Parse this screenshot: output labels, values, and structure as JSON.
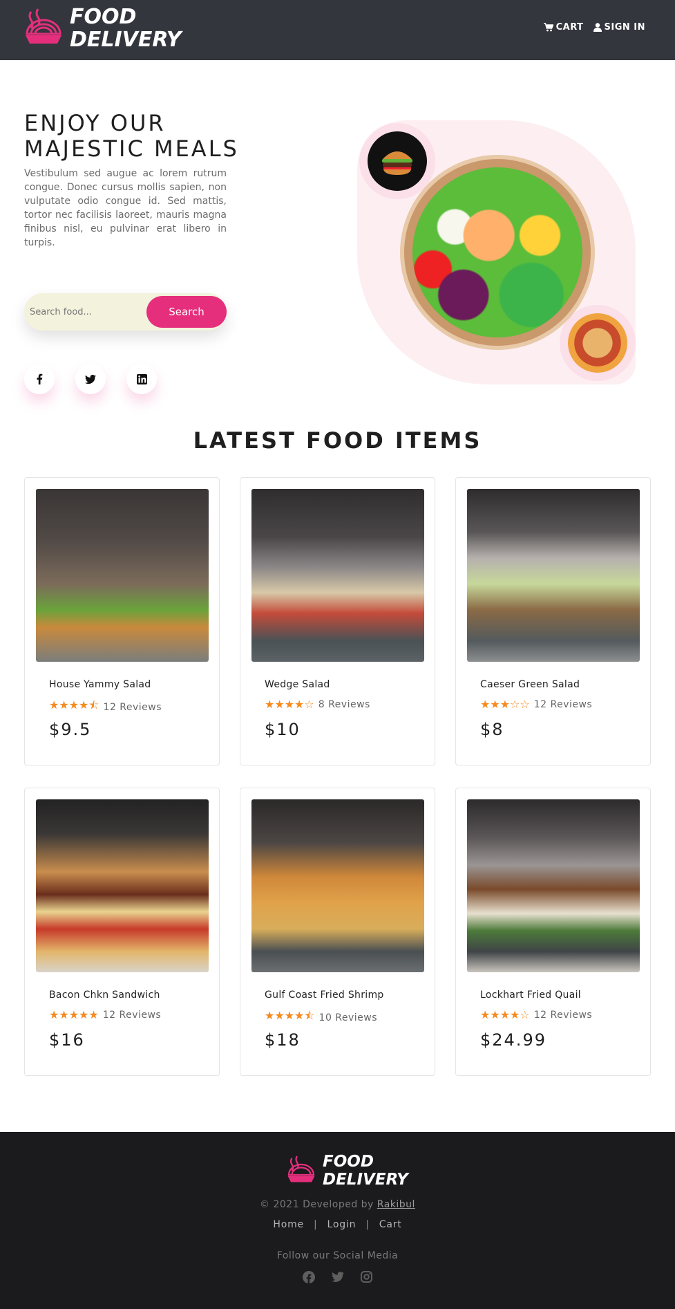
{
  "header": {
    "logo_line1": "FOOD",
    "logo_line2": "DELIVERY",
    "nav": [
      {
        "label": "CART",
        "icon": "cart-icon"
      },
      {
        "label": "SIGN IN",
        "icon": "user-icon"
      }
    ]
  },
  "hero": {
    "title_line1": "ENJOY OUR",
    "title_line2": "MAJESTIC MEALS",
    "description": "Vestibulum sed augue ac lorem rutrum congue. Donec cursus mollis sapien, non vulputate odio congue id. Sed mattis, tortor nec facilisis laoreet, mauris magna finibus nisl, eu pulvinar erat libero in turpis.",
    "search_placeholder": "Search food...",
    "search_button": "Search",
    "socials": [
      "facebook-icon",
      "twitter-icon",
      "linkedin-icon"
    ]
  },
  "latest": {
    "title": "LATEST FOOD ITEMS",
    "items": [
      {
        "name": "House Yammy Salad",
        "stars": "★★★★⯪",
        "reviews": "12 Reviews",
        "price": "$9.5",
        "rating": 4.5
      },
      {
        "name": "Wedge Salad",
        "stars": "★★★★☆",
        "reviews": "8 Reviews",
        "price": "$10",
        "rating": 4
      },
      {
        "name": "Caeser Green Salad",
        "stars": "★★★☆☆",
        "reviews": "12 Reviews",
        "price": "$8",
        "rating": 3
      },
      {
        "name": "Bacon Chkn Sandwich",
        "stars": "★★★★★",
        "reviews": "12 Reviews",
        "price": "$16",
        "rating": 5
      },
      {
        "name": "Gulf Coast Fried Shrimp",
        "stars": "★★★★⯪",
        "reviews": "10 Reviews",
        "price": "$18",
        "rating": 4.5
      },
      {
        "name": "Lockhart Fried Quail",
        "stars": "★★★★☆",
        "reviews": "12 Reviews",
        "price": "$24.99",
        "rating": 4
      }
    ]
  },
  "footer": {
    "logo_line1": "FOOD",
    "logo_line2": "DELIVERY",
    "copyright": "© 2021 Developed by",
    "author": "Rakibul",
    "links": [
      "Home",
      "Login",
      "Cart"
    ],
    "follow": "Follow our Social Media",
    "socials": [
      "facebook-icon",
      "twitter-icon",
      "instagram-icon"
    ]
  },
  "colors": {
    "header_bg": "#33363d",
    "accent": "#e52f7d",
    "star": "#f58a1f",
    "footer_bg": "#1b1b1d"
  }
}
